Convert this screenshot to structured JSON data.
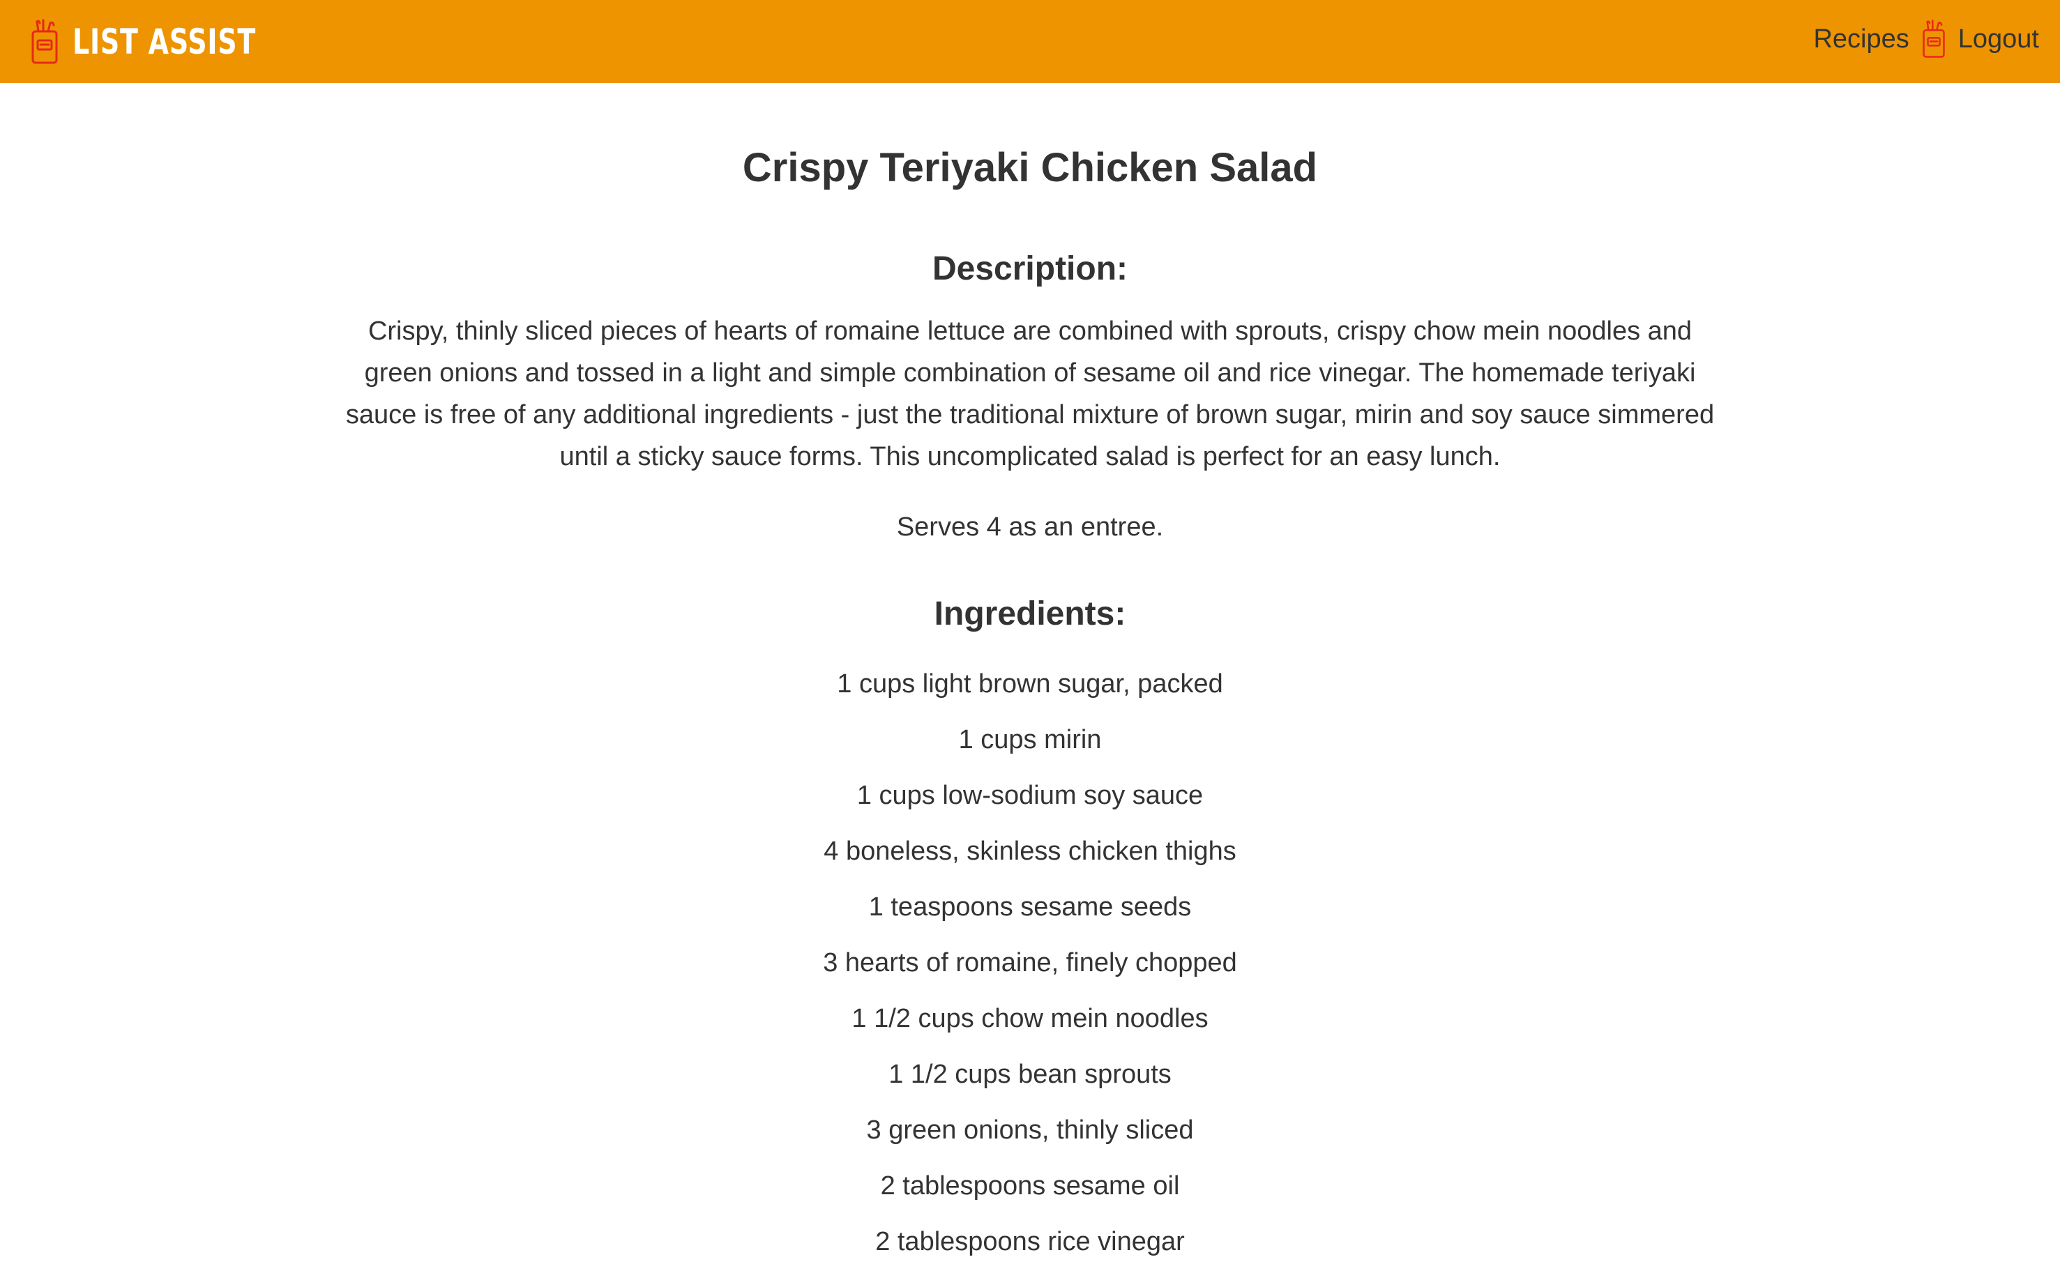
{
  "navbar": {
    "brand_text": "LIST ASSIST",
    "brand_color": "#ee9400",
    "logo_icon": "shopping-bag-icon",
    "links": {
      "recipes": "Recipes",
      "logout": "Logout"
    }
  },
  "recipe": {
    "title": "Crispy Teriyaki Chicken Salad",
    "description_heading": "Description:",
    "description": "Crispy, thinly sliced pieces of hearts of romaine lettuce are combined with sprouts, crispy chow mein noodles and green onions and tossed in a light and simple combination of sesame oil and rice vinegar. The homemade teriyaki sauce is free of any additional ingredients - just the traditional mixture of brown sugar, mirin and soy sauce simmered until a sticky sauce forms. This uncomplicated salad is perfect for an easy lunch.",
    "serves": "Serves 4 as an entree.",
    "ingredients_heading": "Ingredients:",
    "ingredients": [
      "1 cups light brown sugar, packed",
      "1 cups mirin",
      "1 cups low-sodium soy sauce",
      "4 boneless, skinless chicken thighs",
      "1 teaspoons sesame seeds",
      "3 hearts of romaine, finely chopped",
      "1 1/2 cups chow mein noodles",
      "1 1/2 cups bean sprouts",
      "3 green onions, thinly sliced",
      "2 tablespoons sesame oil",
      "2 tablespoons rice vinegar"
    ]
  }
}
